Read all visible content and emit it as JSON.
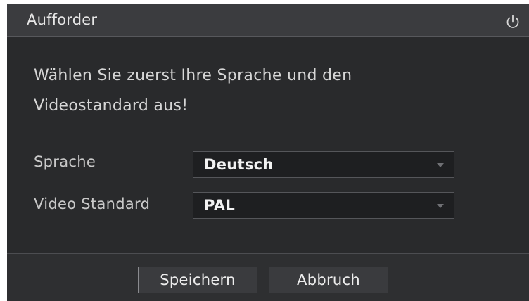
{
  "dialog": {
    "title": "Aufforder",
    "power_icon": "power-icon",
    "message_line1": "Wählen Sie zuerst Ihre Sprache und den",
    "message_line2": "Videostandard aus!"
  },
  "form": {
    "language": {
      "label": "Sprache",
      "value": "Deutsch"
    },
    "video_standard": {
      "label": "Video Standard",
      "value": "PAL"
    }
  },
  "buttons": {
    "save": "Speichern",
    "cancel": "Abbruch"
  },
  "colors": {
    "dialog_bg": "#292a2c",
    "titlebar_bg": "#3b3c3f",
    "field_bg": "#1e1f21",
    "text": "#e6e6e6"
  }
}
